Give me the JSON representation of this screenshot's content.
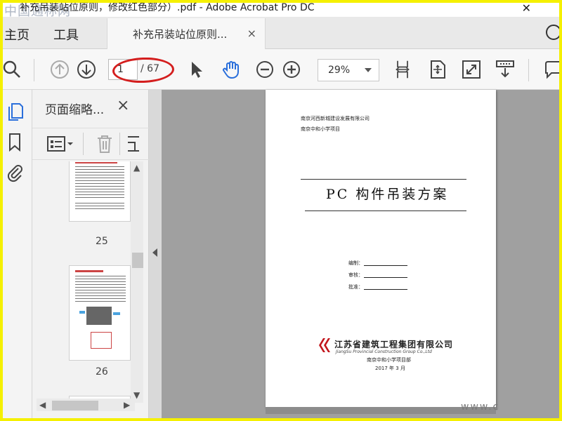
{
  "window": {
    "title": "补充吊装站位原则，修改红色部分）.pdf - Adobe Acrobat Pro DC",
    "watermark": "中国通称网"
  },
  "menubar": {
    "home": "主页",
    "tools": "工具",
    "tab_title": "补充吊装站位原则...",
    "tab_close": "×"
  },
  "toolbar": {
    "current_page": "1",
    "total_pages": "/ 67",
    "zoom": "29%",
    "icons": [
      "search-icon",
      "page-up-icon",
      "page-down-icon",
      "select-arrow-icon",
      "hand-tool-icon",
      "zoom-out-icon",
      "zoom-in-icon",
      "fit-width-icon",
      "fit-page-icon",
      "full-screen-icon",
      "scroll-mode-icon",
      "comment-icon"
    ]
  },
  "thumbnails": {
    "heading": "页面缩略...",
    "close": "×",
    "pages": [
      {
        "number": "25"
      },
      {
        "number": "26"
      }
    ]
  },
  "document": {
    "company_line": "南京河西新城建设发展有限公司",
    "project_line": "南京中和小学项目",
    "title": "PC 构件吊装方案",
    "fields": [
      {
        "label": "编制："
      },
      {
        "label": "审核："
      },
      {
        "label": "批准："
      }
    ],
    "logo_cn": "江苏省建筑工程集团有限公司",
    "logo_en": "JiangSu Provincial Construction Group Co.,Ltd",
    "footer_dept": "南京中和小学项目部",
    "footer_date": "2017 年 3 月"
  },
  "colors": {
    "annotation_red": "#d41e1e",
    "accent_blue": "#2a6fdb",
    "frame_yellow": "#f5f000"
  },
  "corner_watermark": "www.c"
}
